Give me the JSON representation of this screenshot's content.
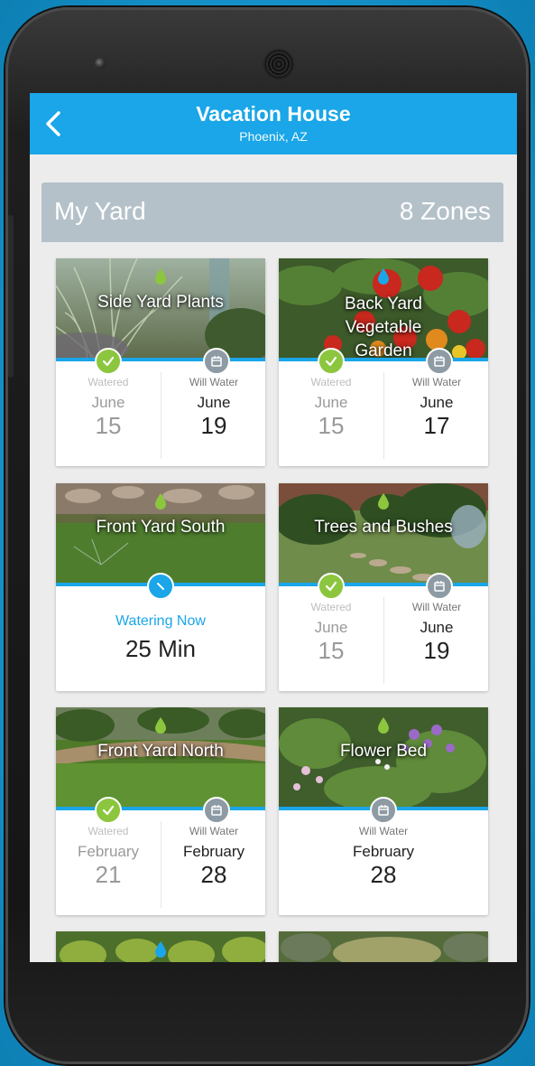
{
  "appbar": {
    "title": "Vacation House",
    "subtitle": "Phoenix, AZ"
  },
  "yard": {
    "title": "My Yard",
    "zones": "8 Zones"
  },
  "zones": [
    {
      "name": "Side Yard Plants",
      "left_label": "Watered",
      "left_month": "June",
      "left_day": "15",
      "right_label": "Will Water",
      "right_month": "June",
      "right_day": "19"
    },
    {
      "name": "Back Yard Vegetable Garden",
      "left_label": "Watered",
      "left_month": "June",
      "left_day": "15",
      "right_label": "Will Water",
      "right_month": "June",
      "right_day": "17"
    },
    {
      "name": "Front Yard South",
      "now_label": "Watering Now",
      "now_value": "25 Min"
    },
    {
      "name": "Trees and Bushes",
      "left_label": "Watered",
      "left_month": "June",
      "left_day": "15",
      "right_label": "Will Water",
      "right_month": "June",
      "right_day": "19"
    },
    {
      "name": "Front Yard North",
      "left_label": "Watered",
      "left_month": "February",
      "left_day": "21",
      "right_label": "Will Water",
      "right_month": "February",
      "right_day": "28"
    },
    {
      "name": "Flower Bed",
      "right_label": "Will Water",
      "right_month": "February",
      "right_day": "28"
    }
  ],
  "icons": {
    "back": "chevron-left-icon",
    "drop": "water-drop-icon",
    "watered": "check-icon",
    "scheduled": "calendar-icon",
    "watering": "timer-icon"
  },
  "colors": {
    "accent": "#1aa6e8",
    "watered_badge": "#8cc63f",
    "scheduled_badge": "#8e9ba5",
    "header_bg": "#b4c1c9"
  }
}
